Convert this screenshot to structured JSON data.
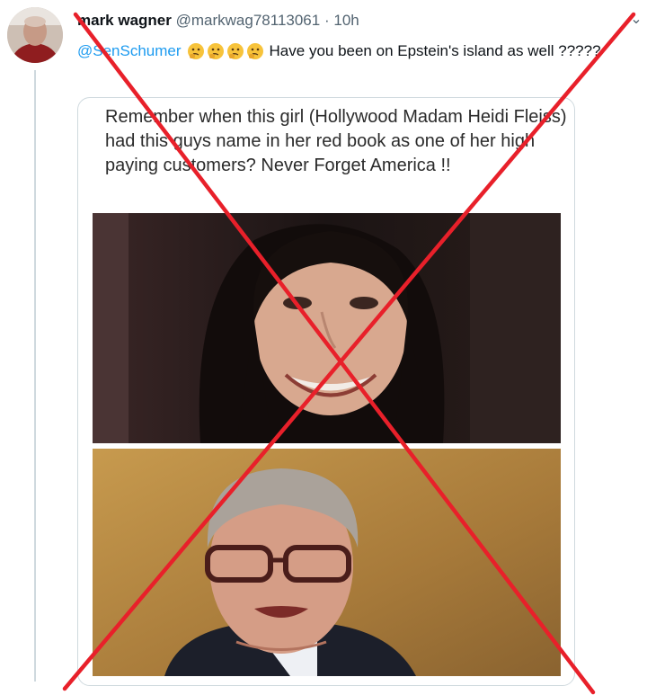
{
  "tweet": {
    "author_name": "mark wagner",
    "author_handle": "@markwag78113061",
    "separator": "·",
    "timestamp": "10h",
    "more_icon": "ellipsis-icon",
    "avatar_icon": "avatar",
    "mention": "@SenSchumer",
    "emojis": [
      "thinking-face-icon",
      "thinking-face-icon",
      "thinking-face-icon",
      "thinking-face-icon"
    ],
    "body_text": "Have you been on Epstein's island as well ?????"
  },
  "quoted": {
    "text": "Remember when this girl (Hollywood Madam Heidi Fleiss) had this guys name in her red book as one of her high paying customers? Never Forget America !!",
    "images": [
      "photo-woman-smiling",
      "photo-man-with-glasses"
    ]
  },
  "overlay": {
    "mark": "red-x-cross-icon",
    "color": "#e8202a"
  }
}
